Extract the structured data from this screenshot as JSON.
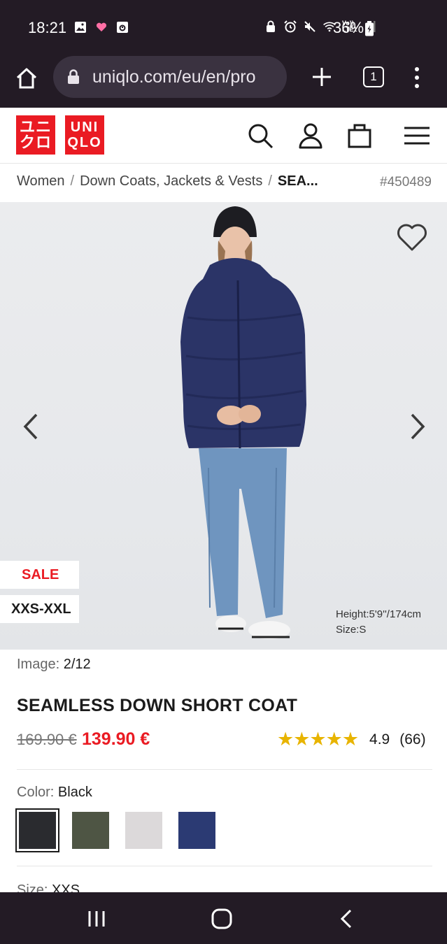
{
  "status_bar": {
    "time": "18:21",
    "network_label": "Vo)) LTE1",
    "battery": "36%",
    "left_icons": [
      "gallery-icon",
      "heart-icon",
      "calendar-icon"
    ],
    "right_icons": [
      "lock-icon",
      "alarm-icon",
      "mute-icon",
      "wifi-icon",
      "signal-icon",
      "battery-icon"
    ]
  },
  "browser": {
    "url": "uniqlo.com/eu/en/pro",
    "tab_count": "1"
  },
  "site_header": {
    "logo_jp_top": "ユニ",
    "logo_jp_bottom": "クロ",
    "logo_en_top": "UNI",
    "logo_en_bottom": "QLO"
  },
  "breadcrumb": {
    "items": [
      "Women",
      "Down Coats, Jackets & Vests"
    ],
    "current": "SEA...",
    "separator": "/",
    "product_number": "#450489"
  },
  "hero": {
    "sale_tag": "SALE",
    "size_tag": "XXS-XXL",
    "model_height": "Height:5'9''/174cm",
    "model_size": "Size:S"
  },
  "product": {
    "image_label": "Image:",
    "image_counter": "2/12",
    "title": "SEAMLESS DOWN SHORT COAT",
    "old_price": "169.90 €",
    "new_price": "139.90 €",
    "stars": "★★★★★",
    "rating": "4.9",
    "review_count": "(66)",
    "color_label": "Color:",
    "color_value": "Black",
    "swatches": [
      {
        "name": "Black",
        "hex": "#2a2b2f"
      },
      {
        "name": "Olive",
        "hex": "#4e5544"
      },
      {
        "name": "Light Gray",
        "hex": "#dcd9da"
      },
      {
        "name": "Navy",
        "hex": "#2b3a73"
      }
    ],
    "size_label": "Size:",
    "size_value": "XXS"
  },
  "colors": {
    "brand_red": "#ea1b23",
    "system_bar": "#231b25",
    "star_gold": "#e8b400"
  }
}
